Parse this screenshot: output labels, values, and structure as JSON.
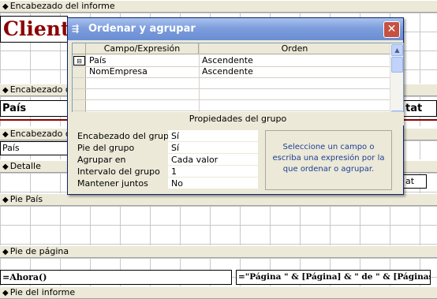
{
  "report": {
    "bands": {
      "report_header": "Encabezado del informe",
      "group_header": "Encabezado de País",
      "page_header": "Encabezado de página",
      "detail": "Detalle",
      "group_footer": "Pie País",
      "page_footer": "Pie de página",
      "report_footer": "Pie del informe"
    },
    "title": "Clients",
    "header_label_pais": "País",
    "header_label_right": "tat",
    "group_field": "País",
    "detail_right": "at",
    "footer_left": "=Ahora()",
    "footer_right": "=\"Página \" & [Página] & \" de \" & [Páginas]"
  },
  "dialog": {
    "title": "Ordenar y agrupar",
    "columns": [
      "Campo/Expresión",
      "Orden"
    ],
    "rows": [
      {
        "field": "País",
        "order": "Ascendente"
      },
      {
        "field": "NomEmpresa",
        "order": "Ascendente"
      }
    ],
    "props_title": "Propiedades del grupo",
    "props": [
      {
        "label": "Encabezado del grupo",
        "value": "Sí"
      },
      {
        "label": "Pie del grupo",
        "value": "Sí"
      },
      {
        "label": "Agrupar en",
        "value": "Cada valor"
      },
      {
        "label": "Intervalo del grupo",
        "value": "1"
      },
      {
        "label": "Mantener juntos",
        "value": "No"
      }
    ],
    "hint": "Seleccione un campo o escriba una expresión por la que ordenar o agrupar."
  }
}
